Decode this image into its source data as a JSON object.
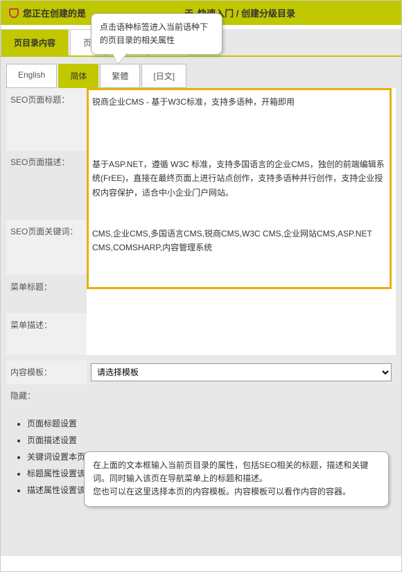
{
  "topbar": {
    "prefix": "您正在创建的是",
    "middle": "于",
    "path": "快速入门 / 创建分级目录"
  },
  "mainTabs": [
    "页目录内容",
    "页",
    "",
    ""
  ],
  "langTabs": [
    "English",
    "简体",
    "繁體",
    "[日文]"
  ],
  "labels": {
    "seoTitle": "SEO页面标题：",
    "seoDesc": "SEO页面描述：",
    "seoKw": "SEO页面关键词：",
    "menuTitle": "菜单标题：",
    "menuDesc": "菜单描述：",
    "tpl": "内容模板：",
    "hidden": "隐藏："
  },
  "fields": {
    "seoTitle": "锐商企业CMS - 基于W3C标准，支持多语种，开箱即用",
    "seoDesc": "基于ASP.NET，遵循 W3C 标准，支持多国语言的企业CMS，独创的前端编辑系统(FrEE)，直接在最终页面上进行站点创作，支持多语种并行创作，支持企业授权内容保护，适合中小企业门户网站。",
    "seoKw": "CMS,企业CMS,多国语言CMS,锐商CMS,W3C CMS,企业网站CMS,ASP.NET CMS,COMSHARP,内容管理系统",
    "menuTitle": "",
    "menuDesc": "",
    "tplPlaceholder": "请选择模板"
  },
  "callouts": {
    "top": "点击语种标签进入当前语种下的页目录的相关属性",
    "bot": "在上面的文本框输入当前页目录的属性，包括SEO相关的标题，描述和关键词。同时输入该页在导航菜单上的标题和描述。\n您也可以在这里选择本页的内容模板。内容模板可以看作内容的容器。"
  },
  "bullets": [
    "页面标题设置",
    "页面描述设置",
    "关键词设置本页在当前语种下的关键词信息。",
    "标题属性设置该页目录在当前语种下的标题。",
    "描述属性设置该项目录在当前语种下的描述。"
  ]
}
